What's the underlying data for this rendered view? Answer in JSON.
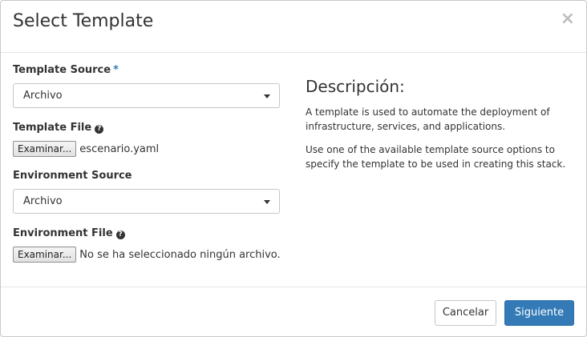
{
  "dialog": {
    "title": "Select Template",
    "close_icon": "close-icon"
  },
  "form": {
    "template_source": {
      "label": "Template Source",
      "required_marker": "*",
      "value": "Archivo"
    },
    "template_file": {
      "label": "Template File",
      "help_icon": "?",
      "button_label": "Examinar...",
      "file_name": "escenario.yaml"
    },
    "environment_source": {
      "label": "Environment Source",
      "value": "Archivo"
    },
    "environment_file": {
      "label": "Environment File",
      "help_icon": "?",
      "button_label": "Examinar...",
      "file_name": "No se ha seleccionado ningún archivo."
    }
  },
  "description": {
    "title": "Descripción:",
    "paragraphs": [
      "A template is used to automate the deployment of infrastructure, services, and applications.",
      "Use one of the available template source options to specify the template to be used in creating this stack."
    ]
  },
  "footer": {
    "cancel_label": "Cancelar",
    "next_label": "Siguiente"
  },
  "colors": {
    "primary": "#337ab7",
    "required": "#337ab7"
  }
}
